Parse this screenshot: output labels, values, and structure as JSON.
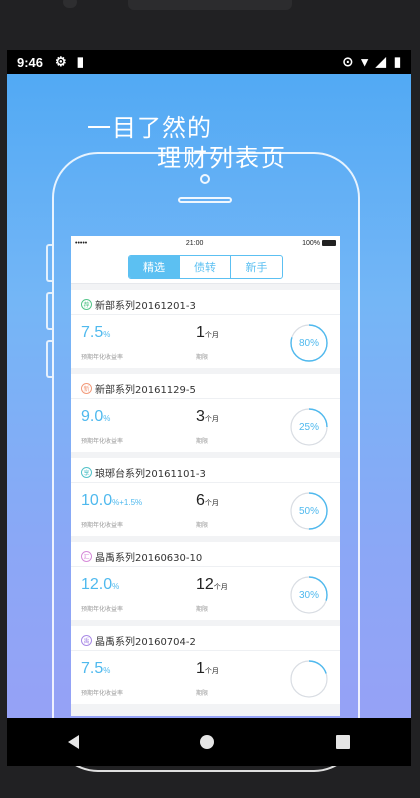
{
  "statusbar": {
    "time": "9:46"
  },
  "hero": {
    "line1": "一目了然的",
    "line2": "理财列表页"
  },
  "inner_status": {
    "carrier": "•••••",
    "time": "21:00",
    "battery": "100%"
  },
  "tabs": [
    {
      "label": "精选",
      "active": true
    },
    {
      "label": "债转",
      "active": false
    },
    {
      "label": "新手",
      "active": false
    }
  ],
  "products": [
    {
      "tag": "荐",
      "tag_color": "#54c58a",
      "name": "新部系列20161201-3",
      "rate": "7.5",
      "rate_unit": "%",
      "rate_label": "预期年化收益率",
      "term": "1",
      "term_unit": "个月",
      "term_label": "期限",
      "progress_text": "80%",
      "progress": 0.8
    },
    {
      "tag": "新",
      "tag_color": "#f29a7a",
      "name": "新部系列20161129-5",
      "rate": "9.0",
      "rate_unit": "%",
      "rate_label": "预期年化收益率",
      "term": "3",
      "term_unit": "个月",
      "term_label": "期限",
      "progress_text": "25%",
      "progress": 0.25
    },
    {
      "tag": "享",
      "tag_color": "#53c2c9",
      "name": "琅琊台系列20161101-3",
      "rate": "10.0",
      "rate_unit": "%+1.5%",
      "rate_label": "预期年化收益率",
      "term": "6",
      "term_unit": "个月",
      "term_label": "期限",
      "progress_text": "50%",
      "progress": 0.5
    },
    {
      "tag": "汇",
      "tag_color": "#d68bd9",
      "name": "晶禹系列20160630-10",
      "rate": "12.0",
      "rate_unit": "%",
      "rate_label": "预期年化收益率",
      "term": "12",
      "term_unit": "个月",
      "term_label": "期限",
      "progress_text": "30%",
      "progress": 0.3
    },
    {
      "tag": "禹",
      "tag_color": "#a98ae6",
      "name": "晶禹系列20160704-2",
      "rate": "7.5",
      "rate_unit": "%",
      "rate_label": "预期年化收益率",
      "term": "1",
      "term_unit": "个月",
      "term_label": "期限",
      "progress_text": "",
      "progress": 0.2
    }
  ],
  "colors": {
    "accent": "#4fb9ee"
  }
}
